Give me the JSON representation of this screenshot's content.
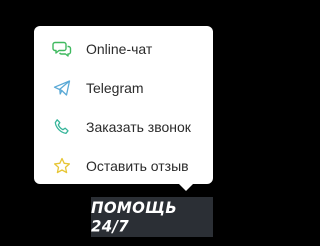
{
  "menu": {
    "items": [
      {
        "label": "Online-чат",
        "icon": "chat-icon",
        "icon_color": "#3fb95f"
      },
      {
        "label": "Telegram",
        "icon": "paper-plane-icon",
        "icon_color": "#5aa9d6"
      },
      {
        "label": "Заказать звонок",
        "icon": "phone-icon",
        "icon_color": "#36b59a"
      },
      {
        "label": "Оставить отзыв",
        "icon": "star-icon",
        "icon_color": "#e7c635"
      }
    ]
  },
  "help_button": {
    "label": "ПОМОЩЬ 24/7",
    "background": "#2b2f35"
  }
}
